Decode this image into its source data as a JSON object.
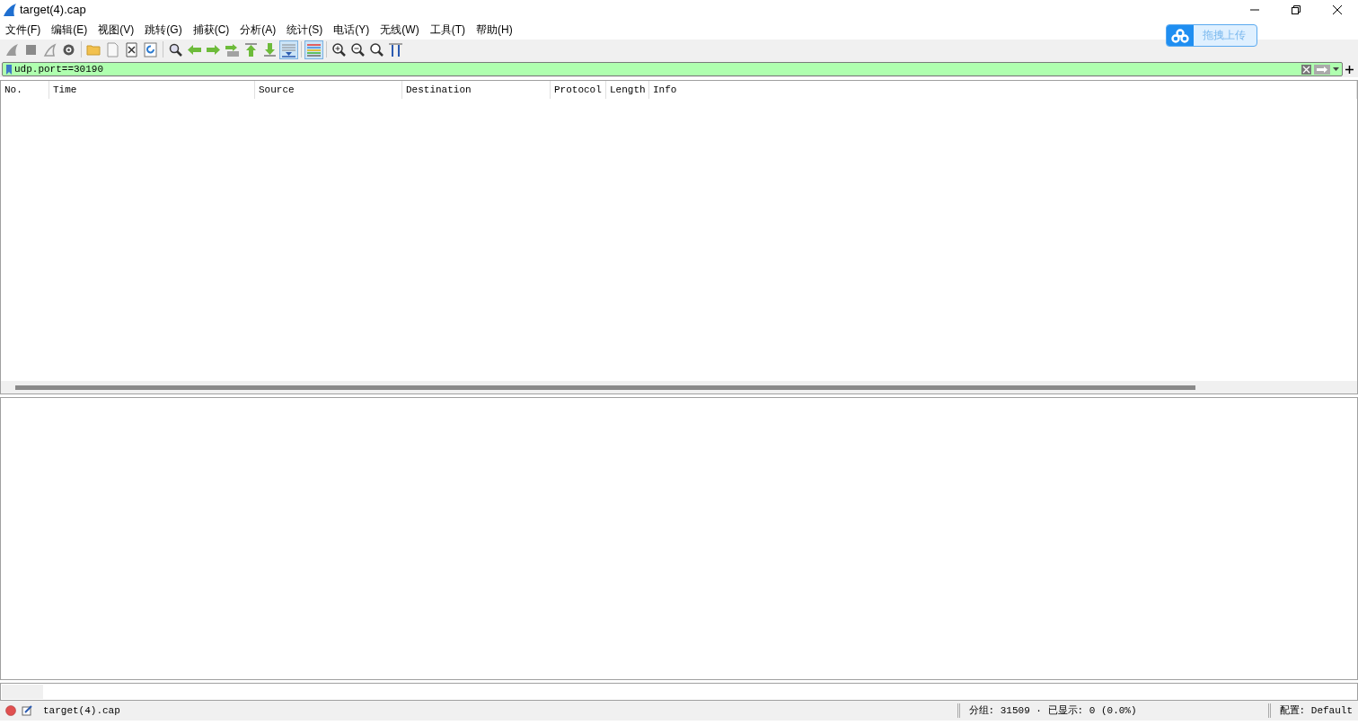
{
  "window": {
    "title": "target(4).cap"
  },
  "menu": [
    "文件(F)",
    "编辑(E)",
    "视图(V)",
    "跳转(G)",
    "捕获(C)",
    "分析(A)",
    "统计(S)",
    "电话(Y)",
    "无线(W)",
    "工具(T)",
    "帮助(H)"
  ],
  "upload_widget": {
    "label": "拖拽上传"
  },
  "toolbar": [
    [
      {
        "kind": "fin",
        "pressed": false
      },
      {
        "kind": "stop",
        "pressed": false
      },
      {
        "kind": "restart",
        "pressed": false
      },
      {
        "kind": "options",
        "pressed": false
      }
    ],
    [
      {
        "kind": "open",
        "pressed": false
      },
      {
        "kind": "file",
        "pressed": false
      },
      {
        "kind": "close",
        "pressed": false
      },
      {
        "kind": "reload",
        "pressed": false
      }
    ],
    [
      {
        "kind": "find",
        "pressed": false
      },
      {
        "kind": "back",
        "pressed": false
      },
      {
        "kind": "forward",
        "pressed": false
      },
      {
        "kind": "goto",
        "pressed": false
      },
      {
        "kind": "first",
        "pressed": false
      },
      {
        "kind": "last",
        "pressed": false
      },
      {
        "kind": "autoscroll",
        "pressed": true
      }
    ],
    [
      {
        "kind": "colorize",
        "pressed": true
      }
    ],
    [
      {
        "kind": "zoomin",
        "pressed": false
      },
      {
        "kind": "zoomout",
        "pressed": false
      },
      {
        "kind": "zoomreset",
        "pressed": false
      },
      {
        "kind": "resize",
        "pressed": false
      }
    ]
  ],
  "filter": {
    "value": "udp.port==30190"
  },
  "packet_list": {
    "columns": [
      "No.",
      "Time",
      "Source",
      "Destination",
      "Protocol",
      "Length",
      "Info"
    ]
  },
  "status_bar": {
    "file": "target(4).cap",
    "counts": "分组: 31509 · 已显示: 0 (0.0%)",
    "profile": "配置: Default"
  }
}
